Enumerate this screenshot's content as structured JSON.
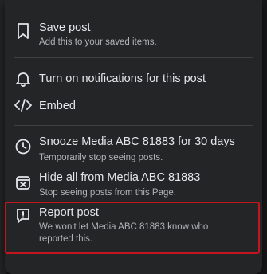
{
  "menu": {
    "items": [
      {
        "id": "save",
        "icon": "bookmark-icon",
        "title": "Save post",
        "subtitle": "Add this to your saved items."
      },
      {
        "id": "notifications",
        "icon": "bell-icon",
        "title": "Turn on notifications for this post",
        "subtitle": ""
      },
      {
        "id": "embed",
        "icon": "code-icon",
        "title": "Embed",
        "subtitle": ""
      },
      {
        "id": "snooze",
        "icon": "clock-icon",
        "title": "Snooze Media ABC 81883 for 30 days",
        "subtitle": "Temporarily stop seeing posts."
      },
      {
        "id": "hide-all",
        "icon": "hide-window-icon",
        "title": "Hide all from Media ABC 81883",
        "subtitle": "Stop seeing posts from this Page."
      },
      {
        "id": "report",
        "icon": "report-flag-icon",
        "title": "Report post",
        "subtitle": "We won't let Media ABC 81883 know who reported this."
      }
    ]
  },
  "colors": {
    "menu_bg": "#242526",
    "text_primary": "#e4e6eb",
    "text_secondary": "#b0b3b8",
    "divider": "#3e4042",
    "highlight_border": "#c4141d"
  }
}
